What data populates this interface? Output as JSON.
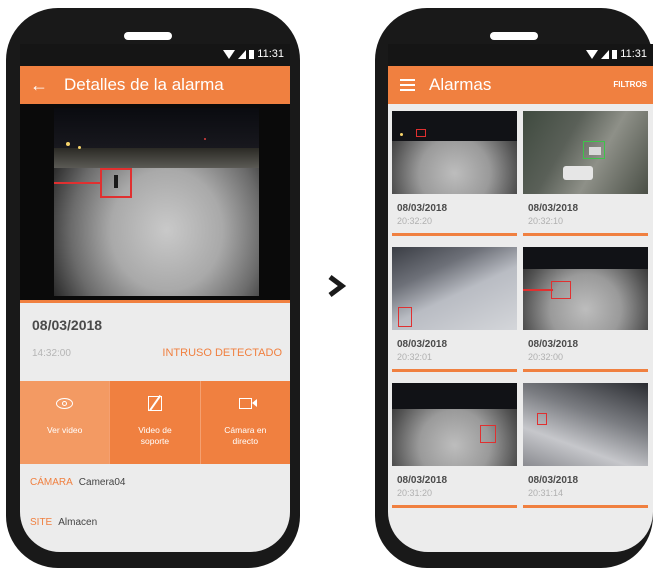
{
  "detail_screen": {
    "status_bar": {
      "time": "11:31"
    },
    "title": "Detalles de la alarma",
    "alarm": {
      "date": "08/03/2018",
      "time": "14:32:00",
      "type": "INTRUSO DETECTADO"
    },
    "actions": [
      {
        "label": "Ver video",
        "icon": "eye-icon"
      },
      {
        "label": "Video de\nsoporte",
        "icon": "video-off-icon"
      },
      {
        "label": "Cámara en\ndirecto",
        "icon": "videocam-icon"
      }
    ],
    "fields": {
      "camera_label": "CÁMARA",
      "camera_value": "Camera04",
      "site_label": "SITE",
      "site_value": "Almacen"
    }
  },
  "list_screen": {
    "status_bar": {
      "time": "11:31"
    },
    "title": "Alarmas",
    "filters_label": "FILTROS",
    "alarms": [
      {
        "date": "08/03/2018",
        "time": "20:32:20"
      },
      {
        "date": "08/03/2018",
        "time": "20:32:10"
      },
      {
        "date": "08/03/2018",
        "time": "20:32:01"
      },
      {
        "date": "08/03/2018",
        "time": "20:32:00"
      },
      {
        "date": "08/03/2018",
        "time": "20:31:20"
      },
      {
        "date": "08/03/2018",
        "time": "20:31:14"
      }
    ]
  },
  "colors": {
    "accent": "#f08040",
    "accent_light": "#f39a63",
    "status_bar": "#151515",
    "phone_body": "#191919",
    "detection_box": "#e03030"
  }
}
